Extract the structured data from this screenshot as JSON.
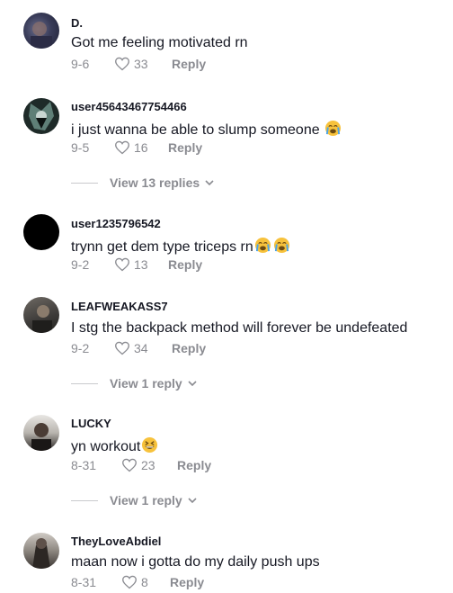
{
  "comments": [
    {
      "username": "D.",
      "text": "Got me feeling motivated rn",
      "emoji": "",
      "date": "9-6",
      "likes": "33",
      "reply_label": "Reply",
      "view_replies": ""
    },
    {
      "username": "user45643467754466",
      "text": "i just wanna be able to slump someone ",
      "emoji": "loudly-crying-emoji",
      "date": "9-5",
      "likes": "16",
      "reply_label": "Reply",
      "view_replies": "View 13 replies"
    },
    {
      "username": "user1235796542",
      "text": "trynn get dem type triceps rn",
      "emoji": "loudly-crying-emoji x2",
      "date": "9-2",
      "likes": "13",
      "reply_label": "Reply",
      "view_replies": ""
    },
    {
      "username": "LEAFWEAKASS7",
      "text": "I stg the backpack method will forever be undefeated",
      "emoji": "",
      "date": "9-2",
      "likes": "34",
      "reply_label": "Reply",
      "view_replies": "View 1 reply"
    },
    {
      "username": "LUCKY",
      "text": "yn workout",
      "emoji": "grinning-squinting-emoji",
      "date": "8-31",
      "likes": "23",
      "reply_label": "Reply",
      "view_replies": "View 1 reply"
    },
    {
      "username": "TheyLoveAbdiel",
      "text": "maan now i gotta do my daily push ups",
      "emoji": "",
      "date": "8-31",
      "likes": "8",
      "reply_label": "Reply",
      "view_replies": ""
    }
  ],
  "colors": {
    "text": "#161823",
    "secondary": "#8a8b91",
    "emoji_face": "#f7c23c",
    "emoji_tears": "#4aa3e8"
  },
  "icons": {
    "like": "heart-outline-icon",
    "chevron": "chevron-down-icon"
  }
}
